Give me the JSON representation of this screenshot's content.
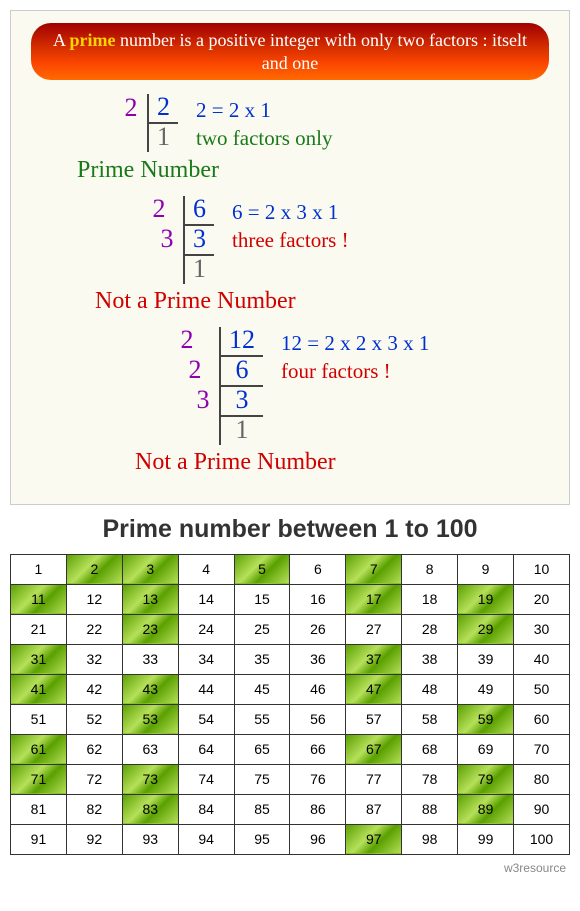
{
  "definition": {
    "pre": "A ",
    "word": "prime",
    "post": " number is a positive integer with only two factors : itselt and one"
  },
  "examples": [
    {
      "key": "ex1",
      "ladder": [
        {
          "d": "2",
          "n": "2"
        },
        {
          "d": "",
          "n": "1"
        }
      ],
      "eq": "2 = 2 x 1",
      "factors_text": "two factors only",
      "factors_class": "fact-line-2",
      "verdict": "Prime Number",
      "verdict_class": "prime"
    },
    {
      "key": "ex2",
      "ladder": [
        {
          "d": "2",
          "n": "6"
        },
        {
          "d": "3",
          "n": "3"
        },
        {
          "d": "",
          "n": "1"
        }
      ],
      "eq": "6 = 2 x 3 x 1",
      "factors_text": "three factors !",
      "factors_class": "fact-line-3",
      "verdict": "Not a Prime Number",
      "verdict_class": "notprime"
    },
    {
      "key": "ex3",
      "ladder": [
        {
          "d": "2",
          "n": "12"
        },
        {
          "d": "2",
          "n": "6"
        },
        {
          "d": "3",
          "n": "3"
        },
        {
          "d": "",
          "n": "1"
        }
      ],
      "eq": "12 = 2 x 2 x 3 x 1",
      "factors_text": "four factors !",
      "factors_class": "fact-line-4",
      "verdict": "Not a Prime Number",
      "verdict_class": "notprime"
    }
  ],
  "grid": {
    "title": "Prime number between 1 to 100",
    "start": 1,
    "end": 100,
    "cols": 10,
    "primes": [
      2,
      3,
      5,
      7,
      11,
      13,
      17,
      19,
      23,
      29,
      31,
      37,
      41,
      43,
      47,
      53,
      59,
      61,
      67,
      71,
      73,
      79,
      83,
      89,
      97
    ]
  },
  "footer": "w3resource",
  "chart_data": {
    "type": "table",
    "title": "Prime number between 1 to 100",
    "range": {
      "start": 1,
      "end": 100
    },
    "columns_per_row": 10,
    "highlighted_primes": [
      2,
      3,
      5,
      7,
      11,
      13,
      17,
      19,
      23,
      29,
      31,
      37,
      41,
      43,
      47,
      53,
      59,
      61,
      67,
      71,
      73,
      79,
      83,
      89,
      97
    ]
  }
}
